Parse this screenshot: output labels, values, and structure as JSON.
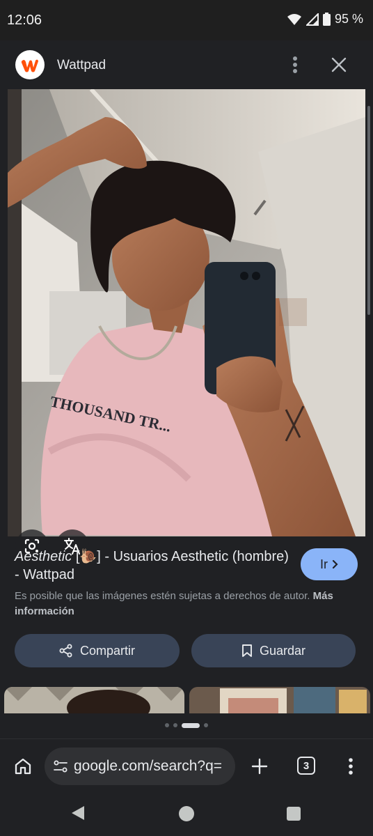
{
  "status_bar": {
    "time": "12:06",
    "battery": "95 %"
  },
  "header": {
    "site_name": "Wattpad",
    "logo_letter": "w",
    "brand_color": "#ff500a"
  },
  "image": {
    "shirt_print": "THOUSAND TR..."
  },
  "overlay_buttons": {
    "lens": "google-lens-icon",
    "translate": "translate-icon"
  },
  "result": {
    "title_italic": "Aesthetic",
    "title_emoji": "[🐌]",
    "title_rest": " - Usuarios Aesthetic (hombre) - Wattpad",
    "go_label": "Ir"
  },
  "copyright": {
    "text": "Es posible que las imágenes estén sujetas a derechos de autor.",
    "more_link": "Más información"
  },
  "actions": {
    "share_label": "Compartir",
    "save_label": "Guardar"
  },
  "pager": {
    "dots": 4,
    "active_index": 2
  },
  "toolbar": {
    "url": "google.com/search?q=",
    "tab_count": "3"
  },
  "colors": {
    "accent": "#8ab4f8",
    "action_bg": "#394457",
    "sheet_bg": "#202124"
  }
}
